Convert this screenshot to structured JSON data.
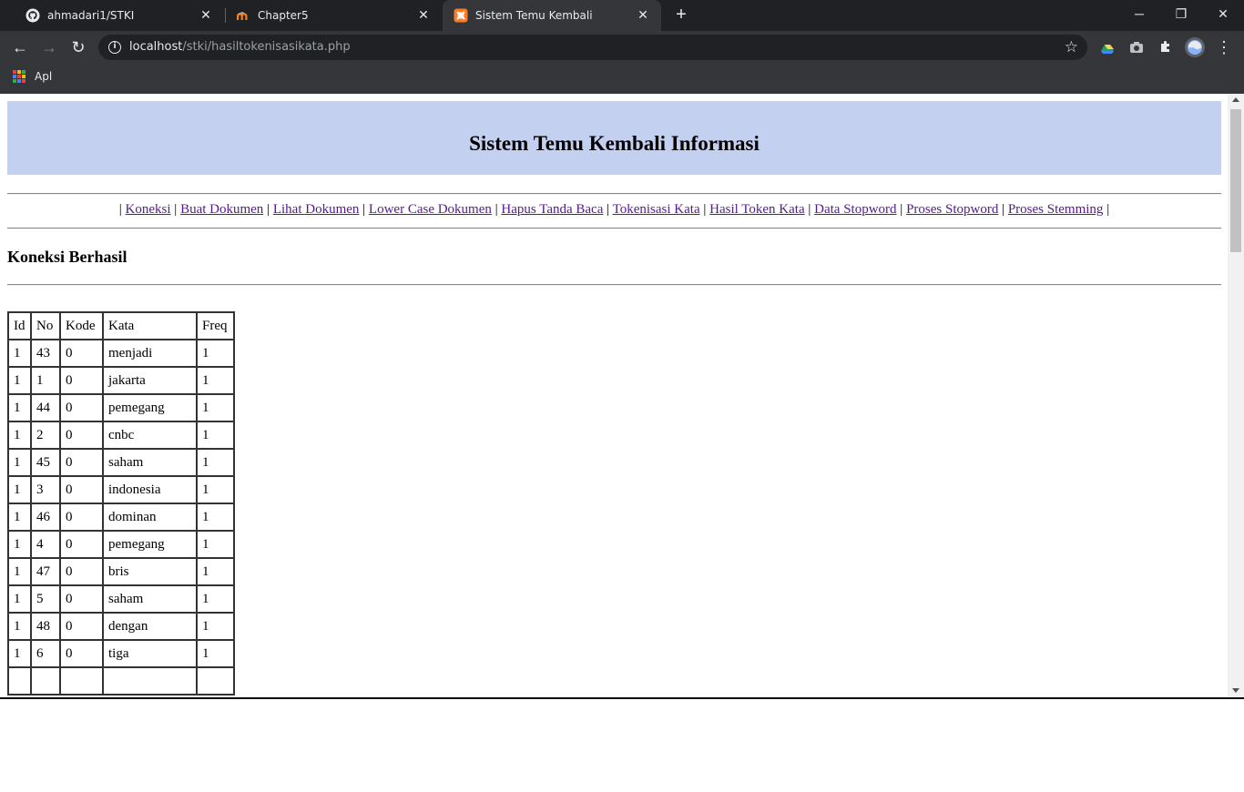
{
  "browser": {
    "tabs": [
      {
        "title": "ahmadari1/STKI",
        "icon": "github-icon"
      },
      {
        "title": "Chapter5",
        "icon": "moodle-icon"
      },
      {
        "title": "Sistem Temu Kembali",
        "icon": "xampp-icon"
      }
    ],
    "url_host": "localhost",
    "url_path": "/stki/hasiltokenisasikata.php",
    "bookmarks_label": "Apl"
  },
  "page": {
    "banner_title": "Sistem Temu Kembali Informasi",
    "menu": [
      "Koneksi",
      "Buat Dokumen",
      "Lihat Dokumen",
      "Lower Case Dokumen",
      "Hapus Tanda Baca",
      "Tokenisasi Kata",
      "Hasil Token Kata",
      "Data Stopword",
      "Proses Stopword",
      "Proses Stemming"
    ],
    "status": "Koneksi Berhasil",
    "table": {
      "headers": [
        "Id",
        "No",
        "Kode",
        "Kata",
        "Freq"
      ],
      "rows": [
        [
          "1",
          "43",
          "0",
          "menjadi",
          "1"
        ],
        [
          "1",
          "1",
          "0",
          "jakarta",
          "1"
        ],
        [
          "1",
          "44",
          "0",
          "pemegang",
          "1"
        ],
        [
          "1",
          "2",
          "0",
          "cnbc",
          "1"
        ],
        [
          "1",
          "45",
          "0",
          "saham",
          "1"
        ],
        [
          "1",
          "3",
          "0",
          "indonesia",
          "1"
        ],
        [
          "1",
          "46",
          "0",
          "dominan",
          "1"
        ],
        [
          "1",
          "4",
          "0",
          "pemegang",
          "1"
        ],
        [
          "1",
          "47",
          "0",
          "bris",
          "1"
        ],
        [
          "1",
          "5",
          "0",
          "saham",
          "1"
        ],
        [
          "1",
          "48",
          "0",
          "dengan",
          "1"
        ],
        [
          "1",
          "6",
          "0",
          "tiga",
          "1"
        ]
      ]
    }
  }
}
